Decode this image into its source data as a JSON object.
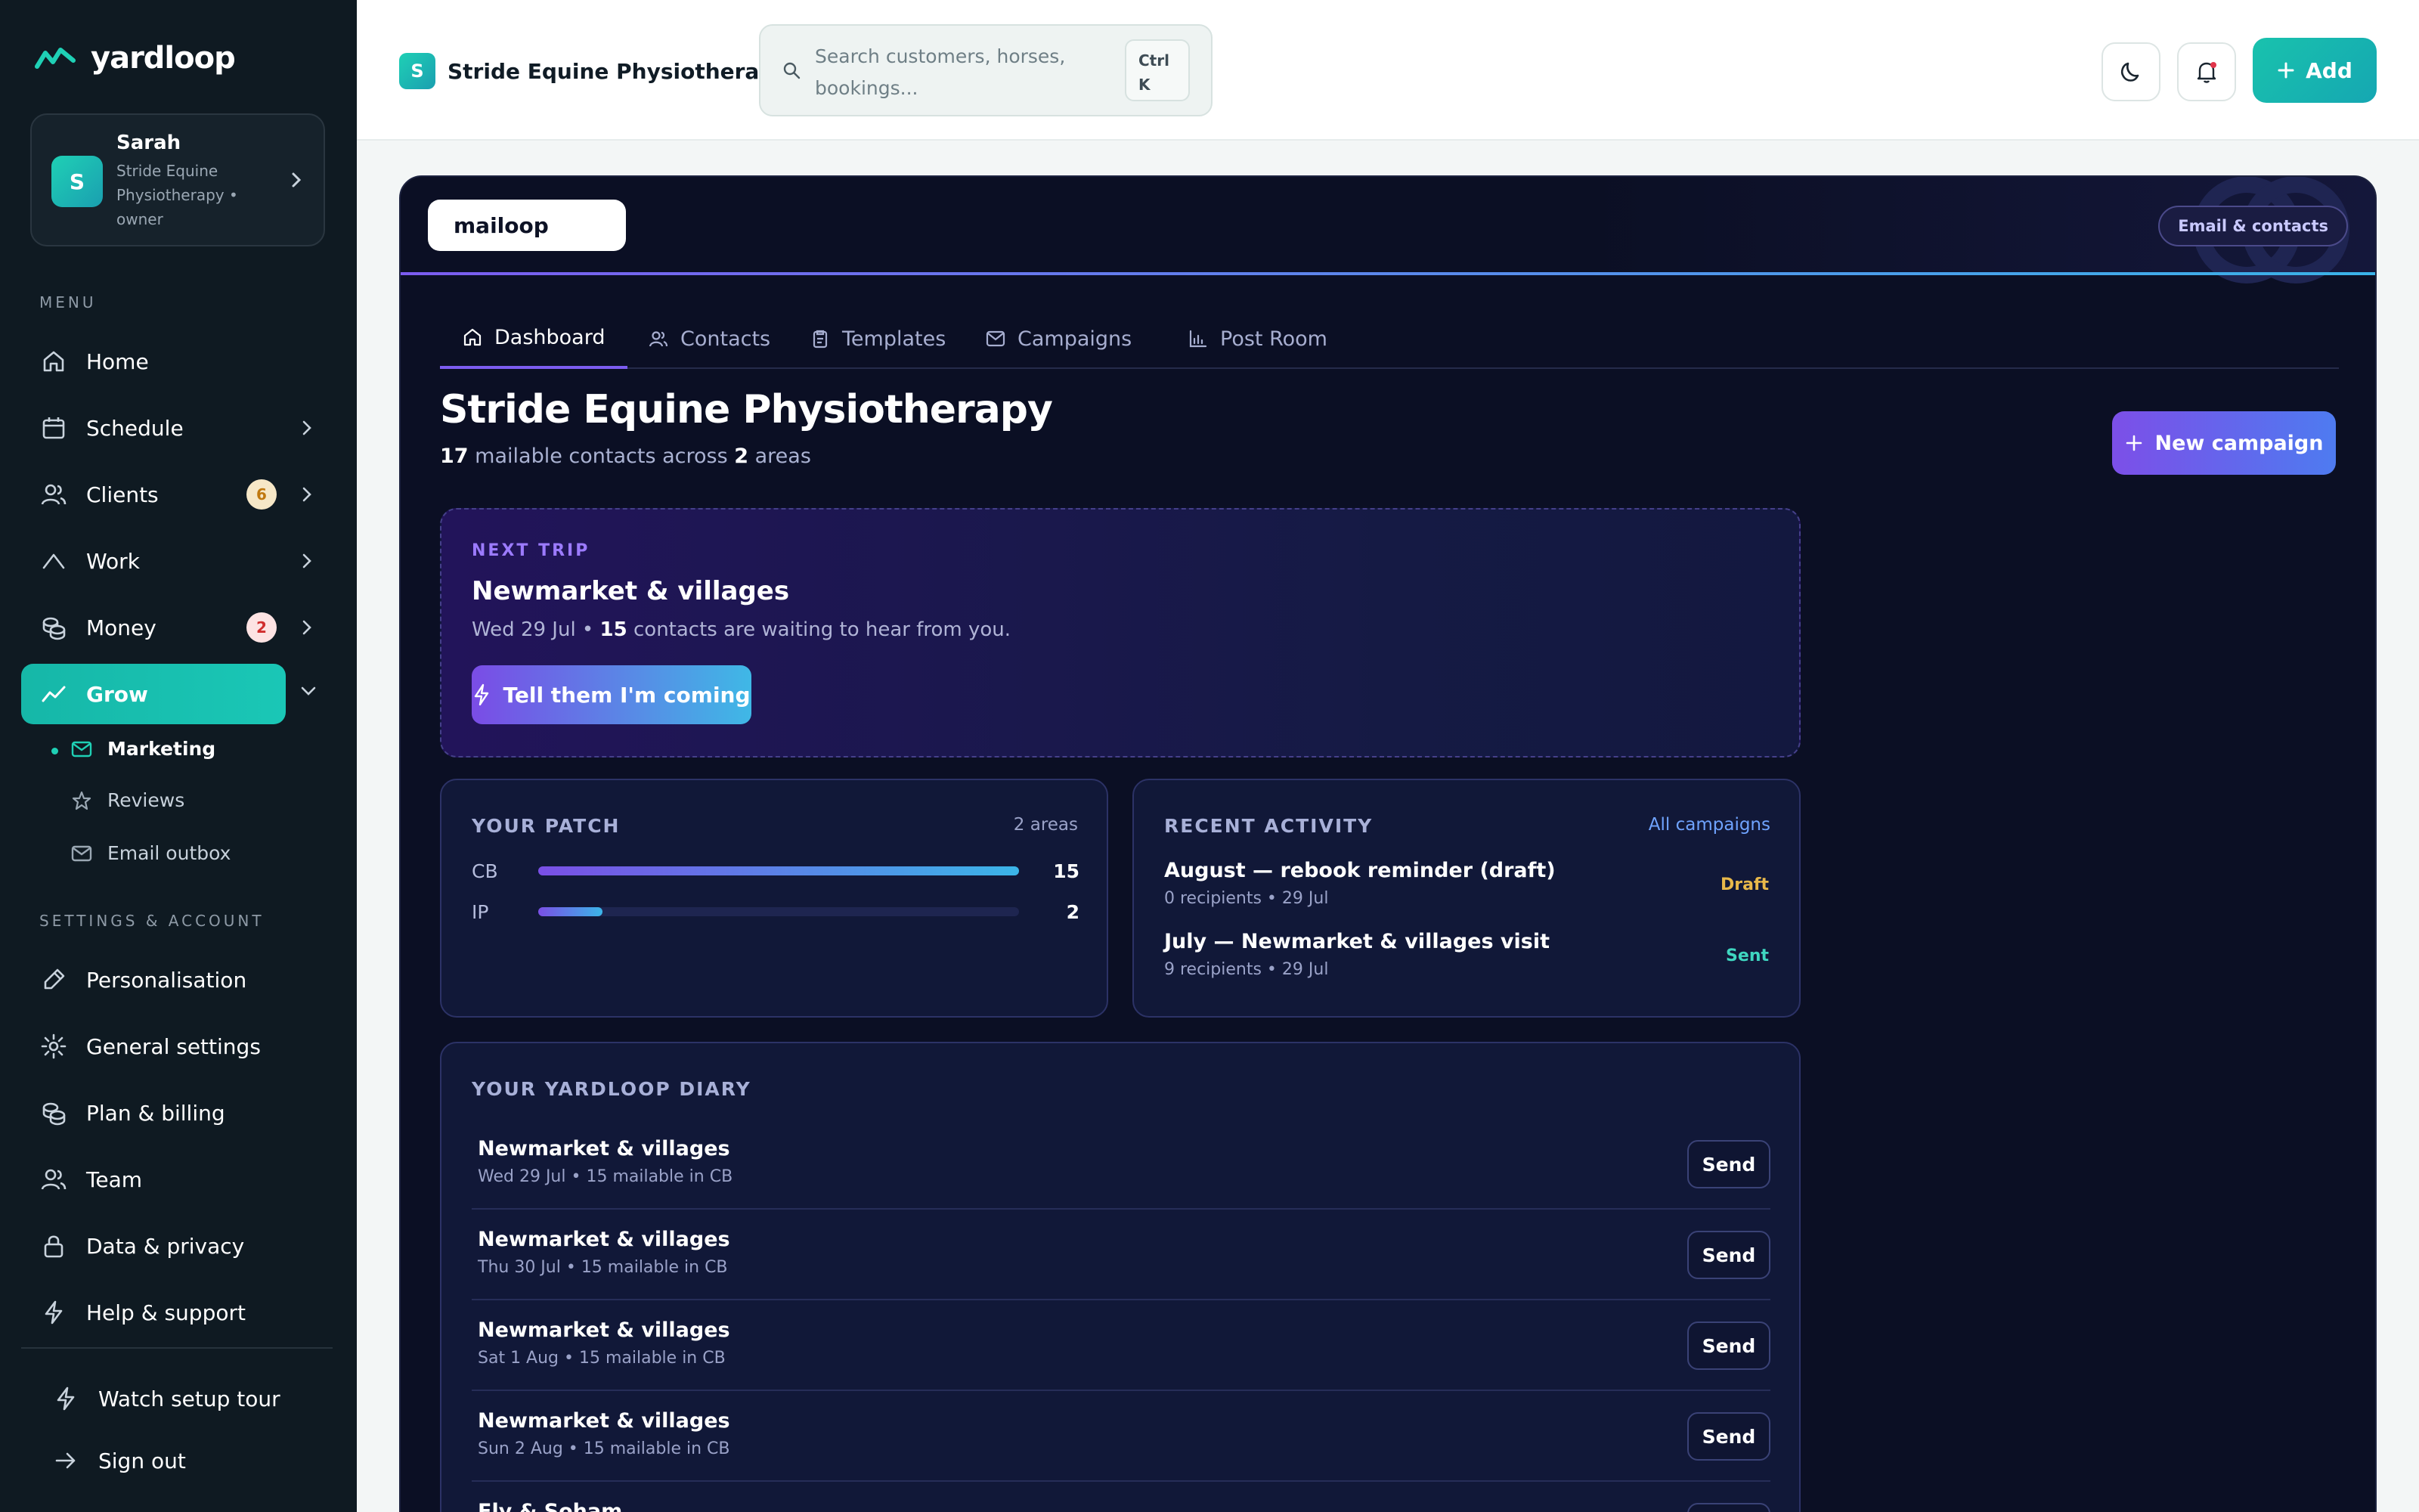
{
  "brand": {
    "name": "yardloop"
  },
  "user": {
    "initial": "S",
    "name": "Sarah",
    "subtitle": "Stride Equine Physiotherapy • owner"
  },
  "sidebar": {
    "menu_label": "MENU",
    "items": [
      {
        "label": "Home",
        "icon": "home-icon"
      },
      {
        "label": "Schedule",
        "icon": "calendar-icon"
      },
      {
        "label": "Clients",
        "icon": "users-icon",
        "badge": "6"
      },
      {
        "label": "Work",
        "icon": "trend-icon"
      },
      {
        "label": "Money",
        "icon": "coins-icon",
        "badge": "2"
      },
      {
        "label": "Grow",
        "icon": "growth-icon"
      }
    ],
    "sub_items": [
      {
        "label": "Marketing",
        "icon": "mail-icon"
      },
      {
        "label": "Reviews",
        "icon": "star-icon"
      },
      {
        "label": "Email outbox",
        "icon": "mail-icon"
      }
    ],
    "settings_label": "SETTINGS & ACCOUNT",
    "settings_items": [
      {
        "label": "Personalisation",
        "icon": "brush-icon"
      },
      {
        "label": "General settings",
        "icon": "gear-icon"
      },
      {
        "label": "Plan & billing",
        "icon": "coins-icon"
      },
      {
        "label": "Team",
        "icon": "users-icon"
      },
      {
        "label": "Data & privacy",
        "icon": "lock-icon"
      },
      {
        "label": "Help & support",
        "icon": "bolt-icon"
      }
    ],
    "footer": [
      {
        "label": "Watch setup tour",
        "icon": "bolt-icon"
      },
      {
        "label": "Sign out",
        "icon": "arrow-right-icon"
      }
    ]
  },
  "topbar": {
    "business_initial": "S",
    "business_name": "Stride Equine Physiotherapy",
    "search_placeholder": "Search customers, horses, bookings...",
    "shortcut_line1": "Ctrl",
    "shortcut_line2": "K",
    "add_label": "Add"
  },
  "mail": {
    "logo_text": "mailoop",
    "section_pill": "Email & contacts",
    "tabs": [
      "Dashboard",
      "Contacts",
      "Templates",
      "Campaigns",
      "Post Room"
    ],
    "title": "Stride Equine Physiotherapy",
    "contacts_count": "17",
    "contacts_text": "mailable contacts across",
    "areas_count": "2",
    "areas_text": "areas",
    "new_campaign_label": "New campaign",
    "next_trip": {
      "kicker": "NEXT TRIP",
      "title": "Newmarket & villages",
      "date": "Wed 29 Jul •",
      "count": "15",
      "text": "contacts are waiting to hear from you.",
      "button": "Tell them I'm coming"
    },
    "patch": {
      "kicker": "YOUR PATCH",
      "areas_label": "2 areas",
      "rows": [
        {
          "code": "CB",
          "value": "15",
          "fraction": 1.0
        },
        {
          "code": "IP",
          "value": "2",
          "fraction": 0.133
        }
      ]
    },
    "activity": {
      "kicker": "RECENT ACTIVITY",
      "link": "All campaigns",
      "items": [
        {
          "title": "August — rebook reminder (draft)",
          "sub": "0 recipients • 29 Jul",
          "status": "Draft",
          "status_color": "#e8b84a"
        },
        {
          "title": "July — Newmarket & villages visit",
          "sub": "9 recipients • 29 Jul",
          "status": "Sent",
          "status_color": "#3fd6c0"
        }
      ]
    },
    "diary": {
      "kicker": "YOUR YARDLOOP DIARY",
      "send_label": "Send",
      "rows": [
        {
          "title": "Newmarket & villages",
          "sub": "Wed 29 Jul • 15 mailable in CB"
        },
        {
          "title": "Newmarket & villages",
          "sub": "Thu 30 Jul • 15 mailable in CB"
        },
        {
          "title": "Newmarket & villages",
          "sub": "Sat 1 Aug • 15 mailable in CB"
        },
        {
          "title": "Newmarket & villages",
          "sub": "Sun 2 Aug • 15 mailable in CB"
        },
        {
          "title": "Ely & Soham",
          "sub": ""
        }
      ]
    }
  },
  "colors": {
    "accent_teal": "#1ac7b6",
    "accent_purple": "#7c5cf0",
    "panel_bg": "#0b0f24"
  }
}
